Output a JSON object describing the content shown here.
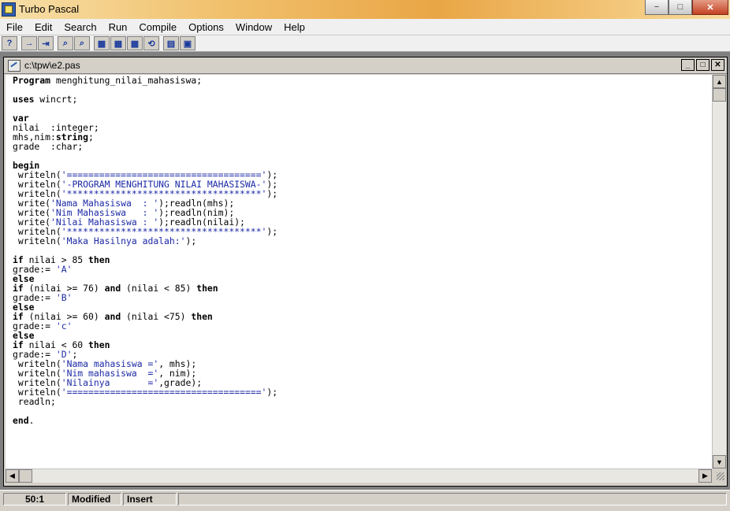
{
  "app": {
    "title": "Turbo Pascal",
    "controls": {
      "minimize": "−",
      "maximize": "□",
      "close": "✕"
    }
  },
  "menu": [
    "File",
    "Edit",
    "Search",
    "Run",
    "Compile",
    "Options",
    "Window",
    "Help"
  ],
  "toolbar": {
    "buttons": [
      {
        "icon": "help-icon",
        "glyph": "?"
      },
      {
        "icon": "open-file-icon",
        "glyph": "→"
      },
      {
        "icon": "save-icon",
        "glyph": "⇥"
      },
      {
        "icon": "find-icon",
        "glyph": "⌕"
      },
      {
        "icon": "search-replace-icon",
        "glyph": "⌕"
      },
      {
        "icon": "compile-icon",
        "glyph": "▦"
      },
      {
        "icon": "make-icon",
        "glyph": "▦"
      },
      {
        "icon": "build-icon",
        "glyph": "▦"
      },
      {
        "icon": "run-icon",
        "glyph": "⟲"
      },
      {
        "icon": "clipboard-icon",
        "glyph": "▤"
      },
      {
        "icon": "memory-icon",
        "glyph": "▣"
      }
    ]
  },
  "editor": {
    "title": "c:\\tpw\\e2.pas",
    "controls": {
      "minimize": "_",
      "maximize": "□",
      "close": "✕"
    },
    "code_lines": [
      "Program menghitung_nilai_mahasiswa;",
      "",
      "uses wincrt;",
      "",
      "var",
      "nilai  :integer;",
      "mhs,nim:string;",
      "grade  :char;",
      "",
      "begin",
      " writeln('====================================');",
      " writeln('-PROGRAM MENGHITUNG NILAI MAHASISWA-');",
      " writeln('************************************');",
      " write('Nama Mahasiswa  : ');readln(mhs);",
      " write('Nim Mahasiswa   : ');readln(nim);",
      " write('Nilai Mahasiswa : ');readln(nilai);",
      " writeln('************************************');",
      " writeln('Maka Hasilnya adalah:');",
      "",
      "if nilai > 85 then",
      "grade:= 'A'",
      "else",
      "if (nilai >= 76) and (nilai < 85) then",
      "grade:= 'B'",
      "else",
      "if (nilai >= 60) and (nilai <75) then",
      "grade:= 'c'",
      "else",
      "if nilai < 60 then",
      "grade:= 'D';",
      " writeln('Nama mahasiswa =', mhs);",
      " writeln('Nim mahasiswa  =', nim);",
      " writeln('Nilainya       =',grade);",
      " writeln('====================================');",
      " readln;",
      "",
      "end."
    ],
    "keywords": [
      "Program",
      "uses",
      "var",
      "begin",
      "if",
      "then",
      "else",
      "and",
      "end",
      "string"
    ]
  },
  "status": {
    "position": "50:1",
    "modified": "Modified",
    "mode": "Insert"
  }
}
